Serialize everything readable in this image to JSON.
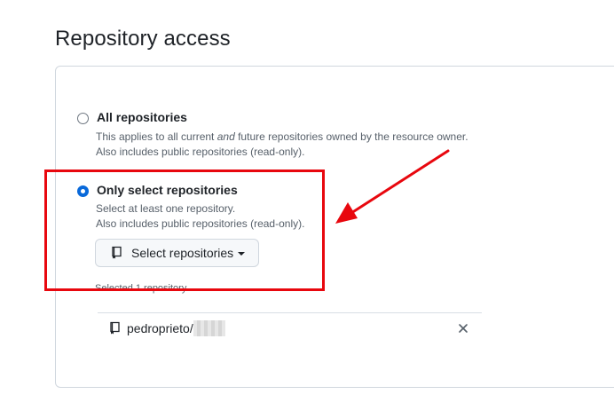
{
  "section": {
    "title": "Repository access"
  },
  "options": {
    "all": {
      "label": "All repositories",
      "note_line1_prefix": "This applies to all current ",
      "note_line1_emphasis": "and",
      "note_line1_suffix": " future repositories owned by the resource owner.",
      "note_line2": "Also includes public repositories (read-only).",
      "checked": false
    },
    "select": {
      "label": "Only select repositories",
      "note_line1": "Select at least one repository.",
      "note_line2": "Also includes public repositories (read-only).",
      "checked": true
    }
  },
  "select_button": {
    "label": "Select repositories",
    "icon": "repo-icon",
    "caret": "chevron-down-icon"
  },
  "selected": {
    "count_text": "Selected 1 repository.",
    "repositories": [
      {
        "owner_prefix": "pedroprieto/",
        "icon": "repo-icon",
        "remove_icon": "close-icon"
      }
    ]
  },
  "annotation": {
    "color": "#e8070e"
  },
  "colors": {
    "accent": "#0969da",
    "border": "#d0d7de",
    "muted_text": "#57606a"
  }
}
